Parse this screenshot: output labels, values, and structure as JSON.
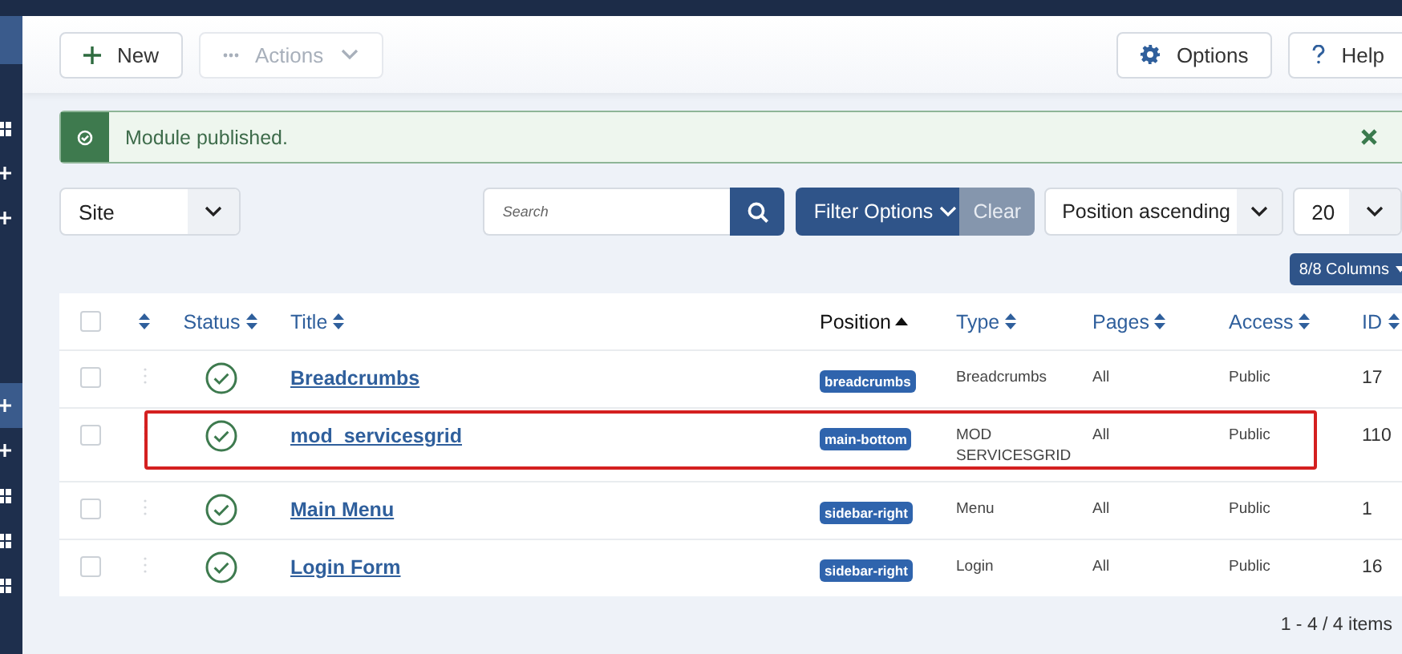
{
  "sidebar": {
    "items": [
      {
        "kind": "blank",
        "selected": true
      },
      {
        "kind": "grid",
        "selected": false
      },
      {
        "kind": "plus",
        "selected": false
      },
      {
        "kind": "plus",
        "selected": false
      },
      {
        "kind": "plus",
        "selected": true
      },
      {
        "kind": "plus",
        "selected": false
      },
      {
        "kind": "grid",
        "selected": false
      },
      {
        "kind": "grid",
        "selected": false
      },
      {
        "kind": "grid",
        "selected": false
      }
    ]
  },
  "toolbar": {
    "left": [
      {
        "kind": "new",
        "label": "New",
        "disabled": false
      },
      {
        "kind": "actions",
        "label": "Actions",
        "disabled": true
      }
    ],
    "right": [
      {
        "kind": "options",
        "label": "Options",
        "disabled": false
      },
      {
        "kind": "help",
        "label": "Help",
        "disabled": false
      }
    ]
  },
  "alert": {
    "message": "Module published."
  },
  "filters": {
    "client": "Site",
    "search": {
      "placeholder": "Search"
    },
    "filter_options": "Filter Options",
    "clear": "Clear",
    "ordering": "Position ascending",
    "limit": "20",
    "columns": "8/8 Columns"
  },
  "table": {
    "columns": [
      {
        "kind": "check",
        "checked": false
      },
      {
        "kind": "order"
      },
      {
        "kind": "sort",
        "label": "Status"
      },
      {
        "kind": "sort",
        "label": "Title"
      },
      {
        "kind": "active",
        "label": "Position"
      },
      {
        "kind": "sort",
        "label": "Type"
      },
      {
        "kind": "sort",
        "label": "Pages"
      },
      {
        "kind": "sort",
        "label": "Access"
      },
      {
        "kind": "sort",
        "label": "ID"
      }
    ],
    "rows": [
      {
        "checked": false,
        "published": true,
        "title": "Breadcrumbs",
        "position": "breadcrumbs",
        "type": "Breadcrumbs",
        "pages": "All",
        "access": "Public",
        "id": "17",
        "highlighted": false
      },
      {
        "checked": false,
        "published": true,
        "title": "mod_servicesgrid",
        "position": "main-bottom",
        "type": "MOD SERVICESGRID",
        "pages": "All",
        "access": "Public",
        "id": "110",
        "highlighted": true
      },
      {
        "checked": false,
        "published": true,
        "title": "Main Menu",
        "position": "sidebar-right",
        "type": "Menu",
        "pages": "All",
        "access": "Public",
        "id": "1",
        "highlighted": false
      },
      {
        "checked": false,
        "published": true,
        "title": "Login Form",
        "position": "sidebar-right",
        "type": "Login",
        "pages": "All",
        "access": "Public",
        "id": "16",
        "highlighted": false
      }
    ]
  },
  "pagination": "1 - 4 / 4 items"
}
